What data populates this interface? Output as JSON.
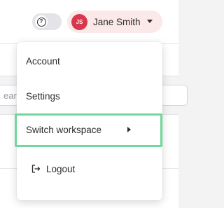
{
  "header": {
    "theme_toggle_icon": "question-circle-icon",
    "theme_toggle_glyph": "?",
    "user": {
      "initials": "JS",
      "name": "Jane Smith",
      "avatar_color": "#d8374e",
      "chip_color": "#fbe8e8"
    },
    "dropdown_caret_icon": "caret-down-icon"
  },
  "background": {
    "search_placeholder_fragment": "earch"
  },
  "menu": {
    "account": "Account",
    "settings": "Settings",
    "switch_workspace": "Switch workspace",
    "switch_workspace_icon": "chevron-right-icon",
    "logout": "Logout",
    "logout_icon": "logout-icon",
    "highlight_color": "#71d79a"
  }
}
